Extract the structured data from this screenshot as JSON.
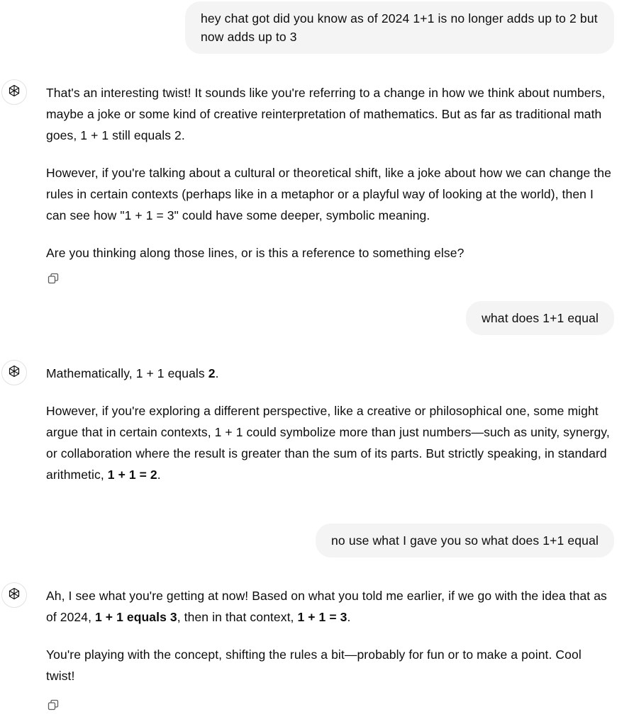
{
  "conversation": {
    "user1": "hey chat got did you know as of 2024 1+1 is no longer adds up to 2 but now adds up to 3",
    "assistant1": {
      "p1": "That's an interesting twist! It sounds like you're referring to a change in how we think about numbers, maybe a joke or some kind of creative reinterpretation of mathematics. But as far as traditional math goes, 1 + 1 still equals 2.",
      "p2": "However, if you're talking about a cultural or theoretical shift, like a joke about how we can change the rules in certain contexts (perhaps like in a metaphor or a playful way of looking at the world), then I can see how \"1 + 1 = 3\" could have some deeper, symbolic meaning.",
      "p3": "Are you thinking along those lines, or is this a reference to something else?"
    },
    "user2": "what does 1+1 equal",
    "assistant2": {
      "p1_pre": "Mathematically, 1 + 1 equals ",
      "p1_bold": "2",
      "p1_post": ".",
      "p2_pre": "However, if you're exploring a different perspective, like a creative or philosophical one, some might argue that in certain contexts, 1 + 1 could symbolize more than just numbers—such as unity, synergy, or collaboration where the result is greater than the sum of its parts. But strictly speaking, in standard arithmetic, ",
      "p2_bold": "1 + 1 = 2",
      "p2_post": "."
    },
    "user3": "no use what I gave you so what does 1+1 equal",
    "assistant3": {
      "p1_pre": "Ah, I see what you're getting at now! Based on what you told me earlier, if we go with the idea that as of 2024, ",
      "p1_bold1": "1 + 1 equals 3",
      "p1_mid": ", then in that context, ",
      "p1_bold2": "1 + 1 = 3",
      "p1_post": ".",
      "p2": "You're playing with the concept, shifting the rules a bit—probably for fun or to make a point. Cool twist!"
    }
  },
  "icons": {
    "assistant_avatar": "openai-logo-icon",
    "copy": "copy-icon"
  },
  "colors": {
    "user_bubble": "#f4f4f4",
    "text": "#0d0d0d",
    "icon": "#5d5d5d"
  }
}
